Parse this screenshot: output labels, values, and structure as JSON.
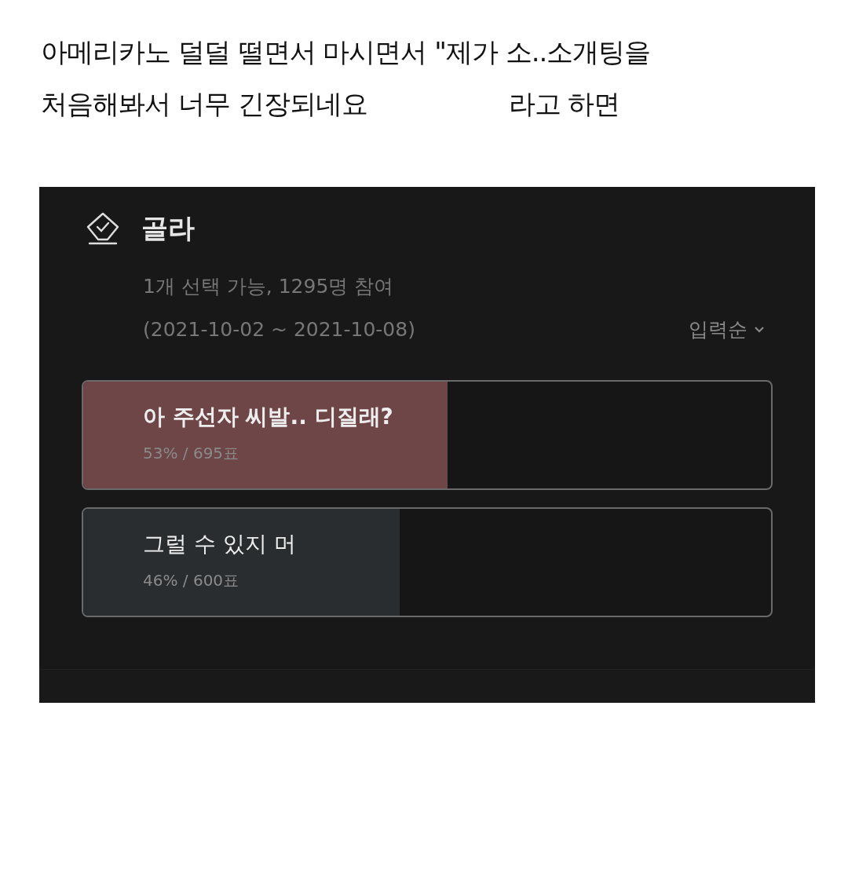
{
  "caption": {
    "lines": [
      [
        "아메리카노 덜덜 떨면서 마시면서 \"제가 소..소개팅을"
      ],
      [
        "처음해봐서 너무 긴장되네요",
        "라고 하면"
      ]
    ]
  },
  "poll": {
    "title": "골라",
    "meta": "1개 선택 가능, 1295명 참여",
    "period": "(2021-10-02 ~ 2021-10-08)",
    "sort": "입력순",
    "options": [
      {
        "label": "아 주선자 씨발.. 디질래?",
        "result": "53% / 695표",
        "level": 0.53,
        "color": "#6e4648"
      },
      {
        "label": "그럴 수 있지 머",
        "result": "46% / 600표",
        "level": 0.46,
        "color": "#2a2d2f"
      }
    ]
  }
}
